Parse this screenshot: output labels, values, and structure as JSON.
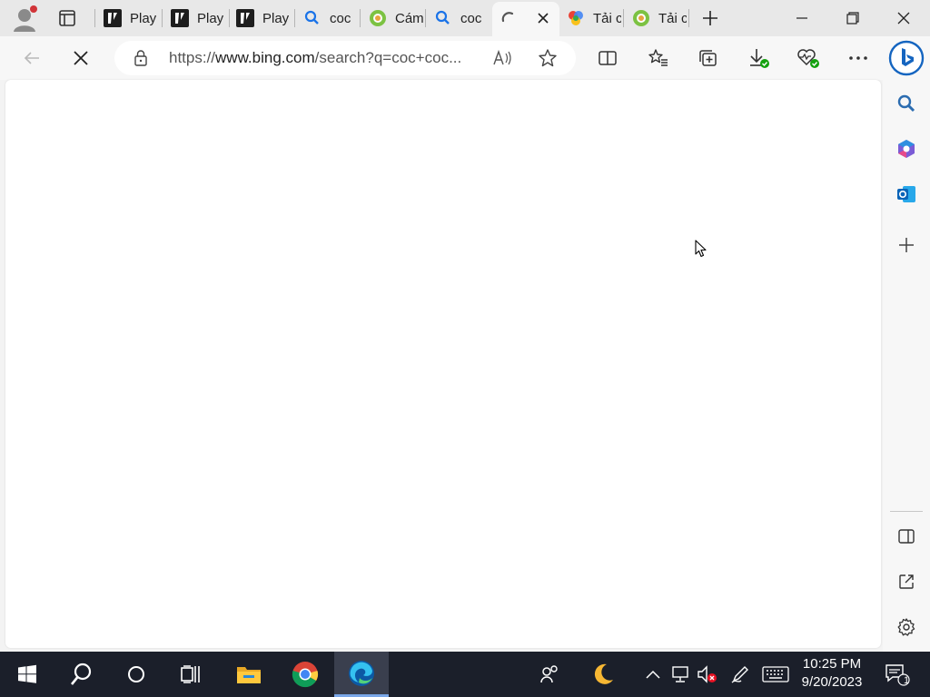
{
  "tabs": [
    {
      "title": "Play",
      "favicon": "play-favicon"
    },
    {
      "title": "Play",
      "favicon": "play-favicon"
    },
    {
      "title": "Play",
      "favicon": "play-favicon"
    },
    {
      "title": "coc",
      "favicon": "search-favicon"
    },
    {
      "title": "Cám",
      "favicon": "coccoc-favicon"
    },
    {
      "title": "coc",
      "favicon": "search-favicon"
    },
    {
      "title": "",
      "favicon": "loading-spinner",
      "active": true
    },
    {
      "title": "Tải c",
      "favicon": "colorful-favicon"
    },
    {
      "title": "Tải c",
      "favicon": "coccoc-favicon"
    }
  ],
  "address_bar": {
    "url_scheme": "https://",
    "url_host": "www.bing.com",
    "url_rest": "/search?q=coc+coc..."
  },
  "status": {
    "loading": true
  },
  "taskbar": {
    "clock_time": "10:25 PM",
    "clock_date": "9/20/2023",
    "notification_count": "1"
  },
  "colors": {
    "edge_blue": "#1565c0",
    "taskbar_bg": "#1b1f2a",
    "tab_strip_bg": "#e8e8e8"
  }
}
